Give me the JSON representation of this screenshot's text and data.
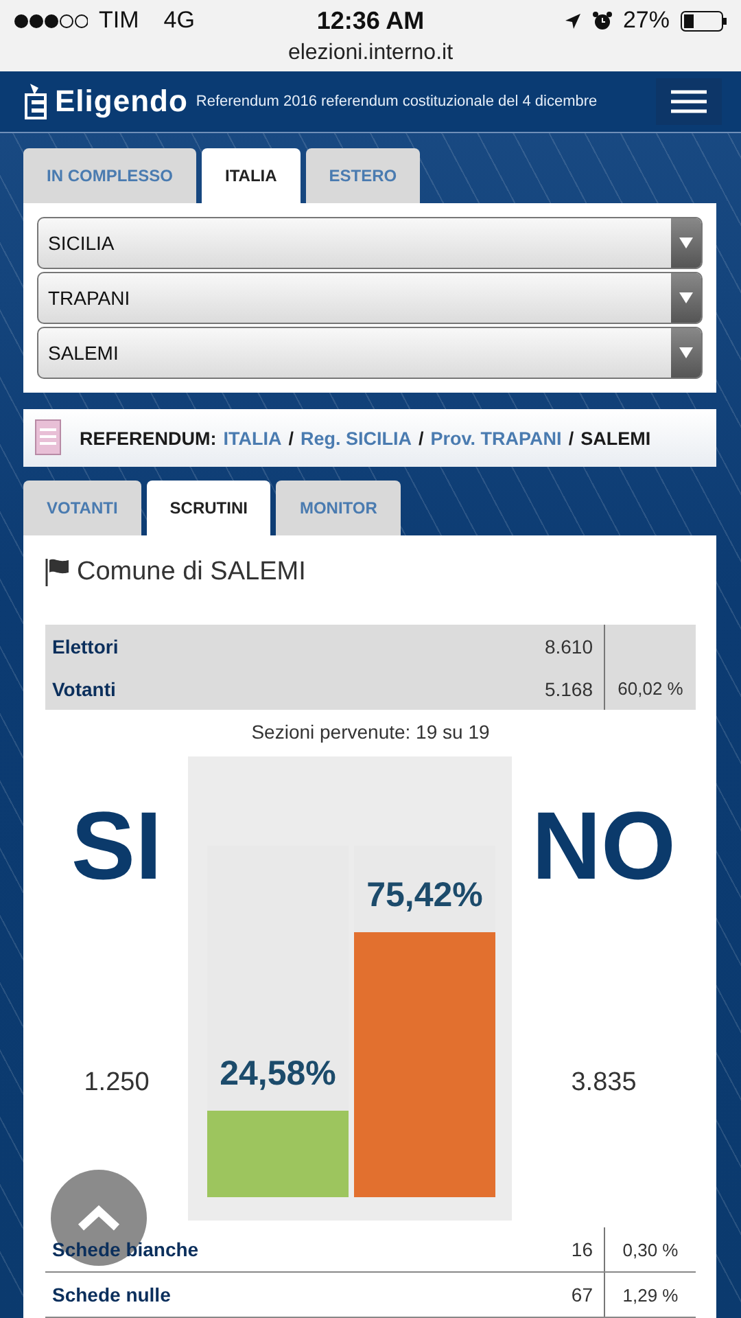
{
  "status_bar": {
    "carrier": "TIM",
    "network": "4G",
    "time": "12:36 AM",
    "battery": "27%",
    "url": "elezioni.interno.it"
  },
  "header": {
    "logo": "Eligendo",
    "subtitle": "Referendum 2016 referendum costituzionale del 4 dicembre"
  },
  "scope_tabs": [
    {
      "label": "IN COMPLESSO",
      "selected": false
    },
    {
      "label": "ITALIA",
      "selected": true
    },
    {
      "label": "ESTERO",
      "selected": false
    }
  ],
  "selects": [
    {
      "value": "SICILIA"
    },
    {
      "value": "TRAPANI"
    },
    {
      "value": "SALEMI"
    }
  ],
  "breadcrumb": {
    "label": "REFERENDUM:",
    "links": [
      "ITALIA",
      "Reg. SICILIA",
      "Prov. TRAPANI"
    ],
    "separator": "/",
    "current": "SALEMI"
  },
  "view_tabs": [
    {
      "label": "VOTANTI",
      "selected": false
    },
    {
      "label": "SCRUTINI",
      "selected": true
    },
    {
      "label": "MONITOR",
      "selected": false
    }
  ],
  "title": "Comune di SALEMI",
  "turnout": [
    {
      "label": "Elettori",
      "value": "8.610"
    },
    {
      "label": "Votanti",
      "value": "5.168",
      "percent": "60,02 %"
    }
  ],
  "sections": "Sezioni pervenute: 19 su 19",
  "results": [
    {
      "label": "SI",
      "votes": "1.250",
      "percent": "24,58%",
      "level": 0.2458,
      "color": "#9dc55e"
    },
    {
      "label": "NO",
      "votes": "3.835",
      "percent": "75,42%",
      "level": 0.7542,
      "color": "#e2702f"
    }
  ],
  "ballots": [
    {
      "label": "Schede bianche",
      "value": "16",
      "percent": "0,30 %"
    },
    {
      "label": "Schede nulle",
      "value": "67",
      "percent": "1,29 %"
    }
  ]
}
